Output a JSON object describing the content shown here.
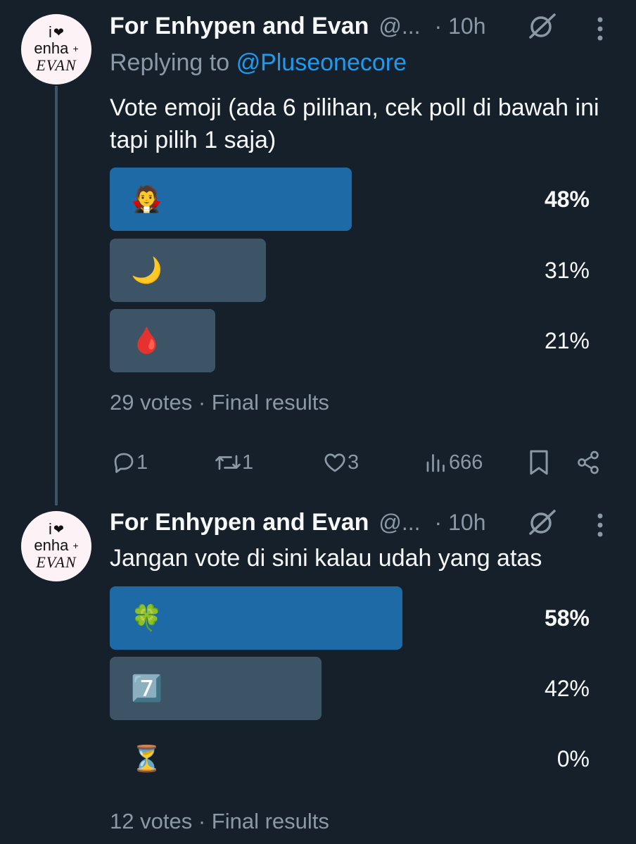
{
  "colors": {
    "background": "#15202b",
    "winner_bar": "#1d6aa6",
    "other_bar": "#3d5466",
    "accent": "#1d9bf0",
    "muted": "#8b98a5"
  },
  "avatar": {
    "line1": "i",
    "heart": "❤",
    "line2": "enha",
    "plus": "+",
    "line3": "EVAN"
  },
  "tweets": [
    {
      "name": "For Enhypen and Evan",
      "handle": "@...",
      "time": "· 10h",
      "replying_label": "Replying to",
      "replying_to": "@Pluseonecore",
      "text": "Vote emoji (ada 6 pilihan, cek poll di bawah ini tapi pilih 1 saja)",
      "poll": {
        "options": [
          {
            "emoji": "🧛",
            "percent_label": "48%",
            "percent": 48,
            "winner": true
          },
          {
            "emoji": "🌙",
            "percent_label": "31%",
            "percent": 31,
            "winner": false
          },
          {
            "emoji": "🩸",
            "percent_label": "21%",
            "percent": 21,
            "winner": false
          }
        ],
        "votes": "29 votes",
        "separator": "·",
        "status": "Final results"
      },
      "actions": {
        "replies": "1",
        "retweets": "1",
        "likes": "3",
        "views": "666"
      }
    },
    {
      "name": "For Enhypen and Evan",
      "handle": "@...",
      "time": "· 10h",
      "text": "Jangan vote di sini kalau udah yang atas",
      "poll": {
        "options": [
          {
            "emoji": "🍀",
            "percent_label": "58%",
            "percent": 58,
            "winner": true
          },
          {
            "emoji": "7️⃣",
            "percent_label": "42%",
            "percent": 42,
            "winner": false
          },
          {
            "emoji": "⏳",
            "percent_label": "0%",
            "percent": 0,
            "winner": false
          }
        ],
        "votes": "12 votes",
        "separator": "·",
        "status": "Final results"
      }
    }
  ]
}
